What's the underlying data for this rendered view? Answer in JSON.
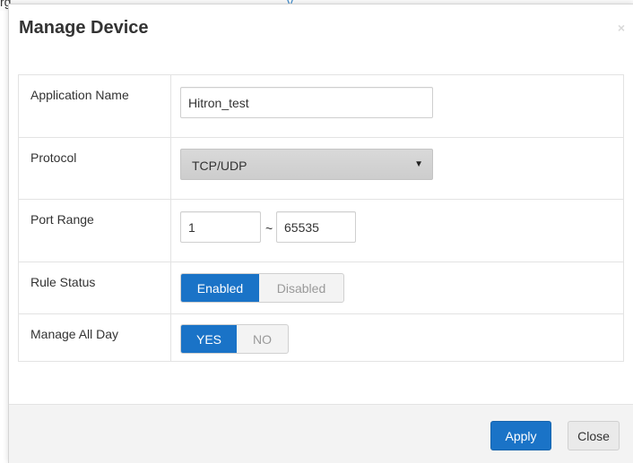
{
  "background": {
    "partial_text": "rg",
    "partial_link": "y"
  },
  "modal": {
    "title": "Manage Device",
    "close_glyph": "×"
  },
  "form": {
    "application_name": {
      "label": "Application Name",
      "value": "Hitron_test"
    },
    "protocol": {
      "label": "Protocol",
      "selected": "TCP/UDP"
    },
    "port_range": {
      "label": "Port Range",
      "start": "1",
      "separator": "~",
      "end": "65535"
    },
    "rule_status": {
      "label": "Rule Status",
      "options": [
        "Enabled",
        "Disabled"
      ],
      "selected": "Enabled"
    },
    "manage_all_day": {
      "label": "Manage All Day",
      "options": [
        "YES",
        "NO"
      ],
      "selected": "YES"
    }
  },
  "footer": {
    "apply_label": "Apply",
    "close_label": "Close"
  },
  "colors": {
    "accent": "#1a73c7",
    "footer_bg": "#f3f3f3",
    "border": "#e3e3e3"
  }
}
